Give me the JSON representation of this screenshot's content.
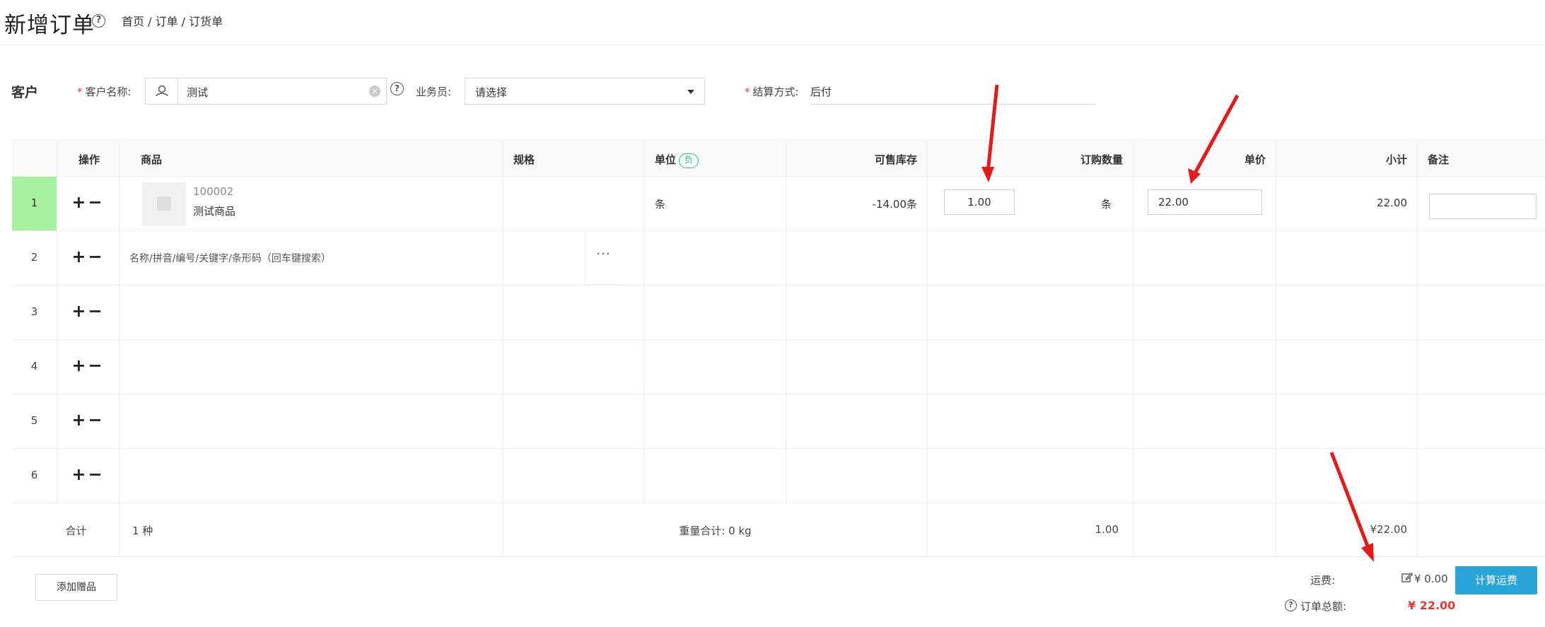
{
  "header": {
    "title": "新增订单",
    "breadcrumb": "首页 / 订单 / 订货单"
  },
  "customer": {
    "section_label": "客户",
    "name_label": "客户名称:",
    "name_value": "测试",
    "salesman_label": "业务员:",
    "salesman_value": "请选择",
    "settlement_label": "结算方式:",
    "settlement_value": "后付"
  },
  "table": {
    "headers": {
      "ops": "操作",
      "product": "商品",
      "spec": "规格",
      "unit": "单位",
      "unit_tag": "负",
      "stock": "可售库存",
      "qty": "订购数量",
      "price": "单价",
      "subtotal": "小计",
      "note": "备注"
    },
    "rows": [
      {
        "index": "1",
        "ops": "+−",
        "code": "100002",
        "name": "测试商品",
        "unit": "条",
        "stock": "-14.00条",
        "qty": "1.00",
        "qty_unit": "条",
        "price": "22.00",
        "subtotal": "22.00"
      },
      {
        "index": "2",
        "ops": "+−",
        "placeholder": "名称/拼音/编号/关键字/条形码（回车键搜索）",
        "more": "···"
      },
      {
        "index": "3",
        "ops": "+−"
      },
      {
        "index": "4",
        "ops": "+−"
      },
      {
        "index": "5",
        "ops": "+−"
      },
      {
        "index": "6",
        "ops": "+−"
      }
    ],
    "summary": {
      "label": "合计",
      "kinds": "1 种",
      "weight": "重量合计: 0 kg",
      "qty_total": "1.00",
      "amount_total": "¥22.00"
    }
  },
  "footer": {
    "add_gift": "添加赠品",
    "freight_label": "运费:",
    "freight_value": "¥ 0.00",
    "calc_freight": "计算运费",
    "total_label": "订单总额:",
    "total_value": "¥ 22.00"
  },
  "colors": {
    "accent_blue": "#29a3d8",
    "price_red": "#e53935",
    "active_row": "#a6f0a0",
    "tag_green": "#2ebd91"
  }
}
